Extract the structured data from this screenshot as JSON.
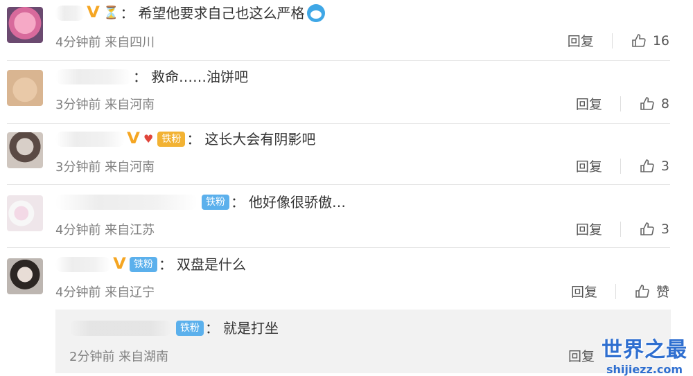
{
  "comments": [
    {
      "text": "希望他要求自己也这么严格",
      "meta": "4分钟前 来自四川",
      "reply_label": "回复",
      "likes": "16"
    },
    {
      "text": "救命……油饼吧",
      "meta": "3分钟前 来自河南",
      "reply_label": "回复",
      "likes": "8"
    },
    {
      "badge": "铁粉",
      "text": "这长大会有阴影吧",
      "meta": "3分钟前 来自河南",
      "reply_label": "回复",
      "likes": "3"
    },
    {
      "badge": "铁粉",
      "text": "他好像很骄傲…",
      "meta": "4分钟前 来自江苏",
      "reply_label": "回复",
      "likes": "3"
    },
    {
      "badge": "铁粉",
      "text": "双盘是什么",
      "meta": "4分钟前 来自辽宁",
      "reply_label": "回复",
      "likes": "赞"
    }
  ],
  "sub_reply": {
    "badge": "铁粉",
    "text": "就是打坐",
    "meta": "2分钟前 来自湖南",
    "reply_label": "回复"
  },
  "colon": "：",
  "watermark": {
    "title": "世界之最",
    "url": "shijiezz.com"
  },
  "colors": {
    "vip": "#f5a623",
    "fan_badge": "#5bb0ec",
    "meta": "#808080",
    "watermark": "#2f6fd0"
  }
}
